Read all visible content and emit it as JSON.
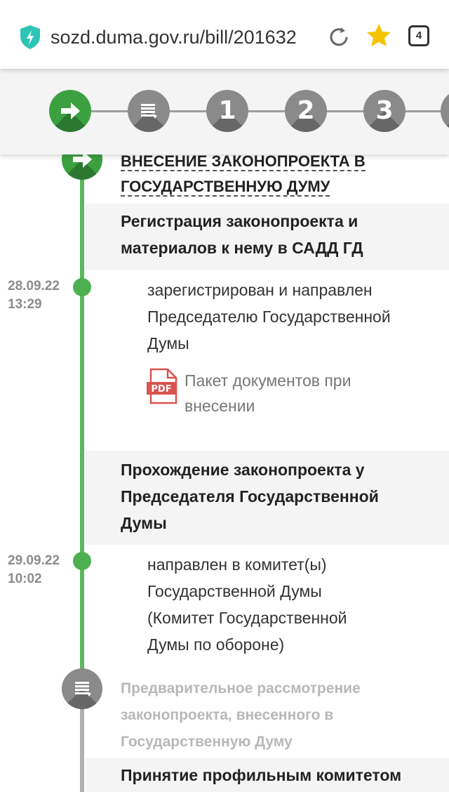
{
  "browser": {
    "url": "sozd.duma.gov.ru/bill/201632",
    "tab_count": "4"
  },
  "stepper": {
    "steps": [
      {
        "label": "",
        "icon": "arrow-right-icon",
        "active": true
      },
      {
        "label": "",
        "icon": "document-list-icon",
        "active": false
      },
      {
        "label": "1",
        "active": false
      },
      {
        "label": "2",
        "active": false
      },
      {
        "label": "3",
        "active": false
      }
    ]
  },
  "stage": {
    "title_line1": "ВНЕСЕНИЕ ЗАКОНОПРОЕКТА В",
    "title_line2": "ГОСУДАРСТВЕННУЮ ДУМУ"
  },
  "events": [
    {
      "title_lines": [
        "Регистрация законопроекта и",
        "материалов к нему в САДД ГД"
      ],
      "date": "28.09.22",
      "time": "13:29",
      "desc_lines": [
        "зарегистрирован и направлен",
        "Председателю Государственной",
        "Думы"
      ],
      "attachment": {
        "icon": "pdf-icon",
        "label_lines": [
          "Пакет документов при",
          "внесении"
        ],
        "badge": "PDF"
      }
    },
    {
      "title_lines": [
        "Прохождение законопроекта у",
        "Председателя Государственной",
        "Думы"
      ],
      "date": "29.09.22",
      "time": "10:02",
      "desc_lines": [
        "направлен в комитет(ы)",
        "Государственной Думы",
        "(Комитет Государственной",
        "Думы по обороне)"
      ]
    }
  ],
  "next_stage": {
    "title_lines": [
      "Предварительное рассмотрение",
      "законопроекта, внесенного в",
      "Государственную Думу"
    ],
    "event_title": "Принятие профильным комитетом"
  },
  "colors": {
    "accent_green": "#3aa040",
    "timeline_green": "#5cb85c",
    "inactive_gray": "#8a8a8a",
    "pdf_red": "#d9534f"
  }
}
